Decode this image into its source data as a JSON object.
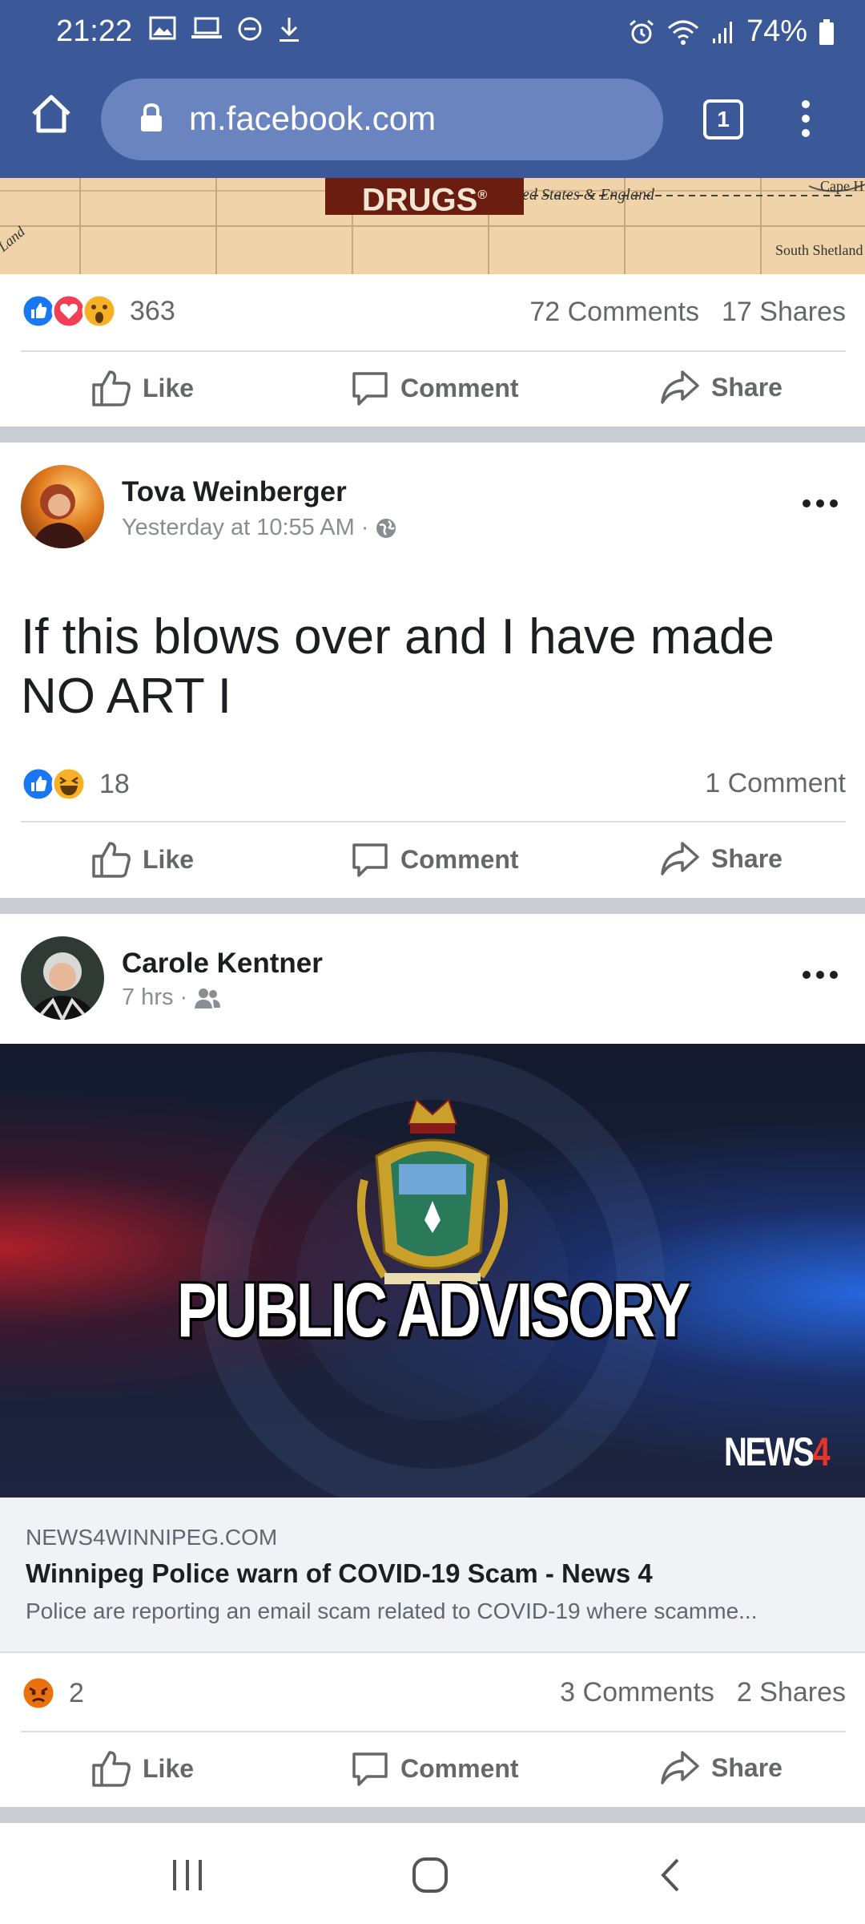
{
  "status_bar": {
    "time": "21:22",
    "battery": "74%"
  },
  "browser": {
    "url": "m.facebook.com",
    "tab_count": "1"
  },
  "map_strip": {
    "label": "DRUGS",
    "registered_mark": "®",
    "text_states": "ed States & England",
    "text_cape": "Cape H",
    "text_south": "South Shetland",
    "text_land": "Land"
  },
  "post1_footer": {
    "reaction_count": "363",
    "comments": "72 Comments",
    "shares": "17 Shares"
  },
  "actions": {
    "like": "Like",
    "comment": "Comment",
    "share": "Share"
  },
  "post2": {
    "author": "Tova Weinberger",
    "time": "Yesterday at 10:55 AM ·",
    "text": "If this blows over and I have made NO ART I",
    "reaction_count": "18",
    "comments": "1 Comment"
  },
  "post3": {
    "author": "Carole Kentner",
    "time": "7 hrs ·",
    "image_text": "PUBLIC ADVISORY",
    "news_logo": "NEWS",
    "news_logo_num": "4",
    "link_domain": "NEWS4WINNIPEG.COM",
    "link_title": "Winnipeg Police warn of COVID-19 Scam - News 4",
    "link_desc": "Police are reporting an email scam related to COVID-19 where scamme...",
    "reaction_count": "2",
    "comments": "3 Comments",
    "shares": "2 Shares"
  },
  "colors": {
    "brand_blue": "#3b5998",
    "like_blue": "#1877f2",
    "love_red": "#f33e58",
    "haha_yellow": "#f7b125",
    "angry_orange": "#e9710f"
  },
  "icons": [
    "home-icon",
    "lock-icon",
    "tabs-icon",
    "kebab-icon",
    "like-icon",
    "comment-icon",
    "share-icon",
    "globe-icon",
    "friends-icon",
    "more-icon"
  ]
}
